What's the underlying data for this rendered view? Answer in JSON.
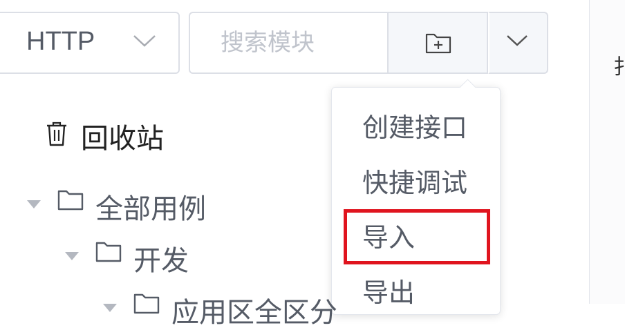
{
  "toolbar": {
    "protocol_select": {
      "value": "HTTP"
    },
    "search": {
      "placeholder": "搜索模块",
      "value": ""
    },
    "new_folder_icon": "folder-plus-icon",
    "dropdown_icon": "chevron-down-icon"
  },
  "dropdown_menu": {
    "items": [
      {
        "label": "创建接口"
      },
      {
        "label": "快捷调试"
      },
      {
        "label": "导入",
        "highlighted": true
      },
      {
        "label": "导出"
      }
    ],
    "highlight_color": "#e0141e"
  },
  "tree": {
    "recycle_bin": {
      "label": "回收站",
      "icon": "trash-icon"
    },
    "nodes": [
      {
        "label": "全部用例"
      },
      {
        "label": "开发"
      },
      {
        "label": "应用区全区分"
      }
    ]
  },
  "colors": {
    "border": "#dcdfe6",
    "text": "#555b66",
    "placeholder": "#c0c4cc",
    "button_bg": "#f5f7fa"
  }
}
